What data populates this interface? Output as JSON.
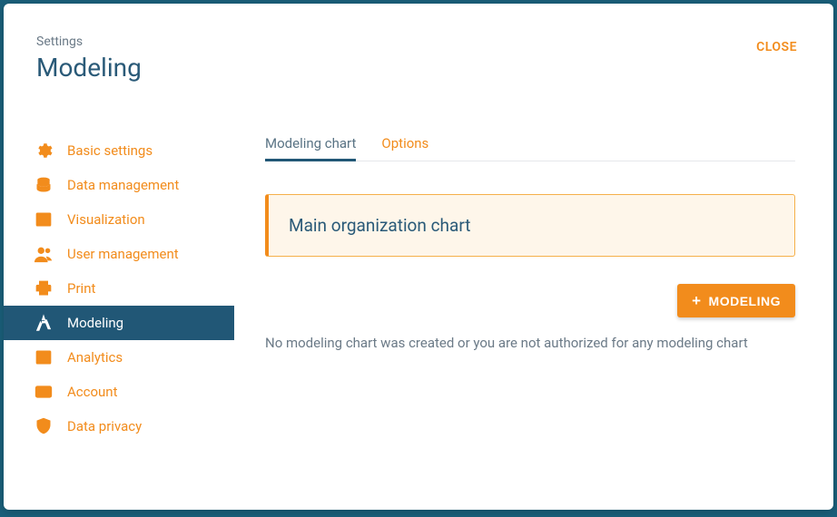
{
  "header": {
    "breadcrumb": "Settings",
    "title": "Modeling",
    "close_label": "CLOSE"
  },
  "sidebar": {
    "items": [
      {
        "id": "basic-settings",
        "label": "Basic settings",
        "icon": "gear-icon"
      },
      {
        "id": "data-management",
        "label": "Data management",
        "icon": "database-icon"
      },
      {
        "id": "visualization",
        "label": "Visualization",
        "icon": "grid-icon"
      },
      {
        "id": "user-management",
        "label": "User management",
        "icon": "users-icon"
      },
      {
        "id": "print",
        "label": "Print",
        "icon": "printer-icon"
      },
      {
        "id": "modeling",
        "label": "Modeling",
        "icon": "compass-icon",
        "active": true
      },
      {
        "id": "analytics",
        "label": "Analytics",
        "icon": "chart-icon"
      },
      {
        "id": "account",
        "label": "Account",
        "icon": "card-icon"
      },
      {
        "id": "data-privacy",
        "label": "Data privacy",
        "icon": "shield-icon"
      }
    ]
  },
  "tabs": [
    {
      "id": "modeling-chart",
      "label": "Modeling chart",
      "active": true
    },
    {
      "id": "options",
      "label": "Options"
    }
  ],
  "chart_card": {
    "title": "Main organization chart"
  },
  "add_button": {
    "label": "MODELING"
  },
  "empty_message": "No modeling chart was created or you are not authorized for any modeling chart"
}
